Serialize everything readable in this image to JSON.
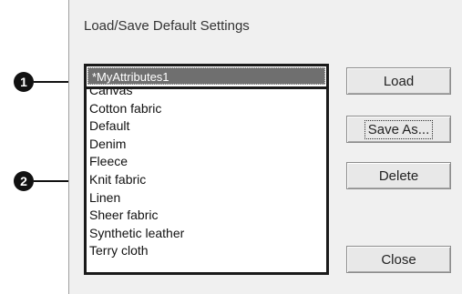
{
  "dialog": {
    "title": "Load/Save Default Settings",
    "name_field_value": "*MyAttributes1",
    "list_items": [
      "Canvas",
      "Cotton fabric",
      "Default",
      "Denim",
      "Fleece",
      "Knit fabric",
      "Linen",
      "Sheer fabric",
      "Synthetic leather",
      "Terry cloth"
    ],
    "buttons": {
      "load": "Load",
      "save_as": "Save As...",
      "delete": "Delete",
      "close": "Close"
    }
  },
  "callouts": {
    "one": "1",
    "two": "2"
  }
}
